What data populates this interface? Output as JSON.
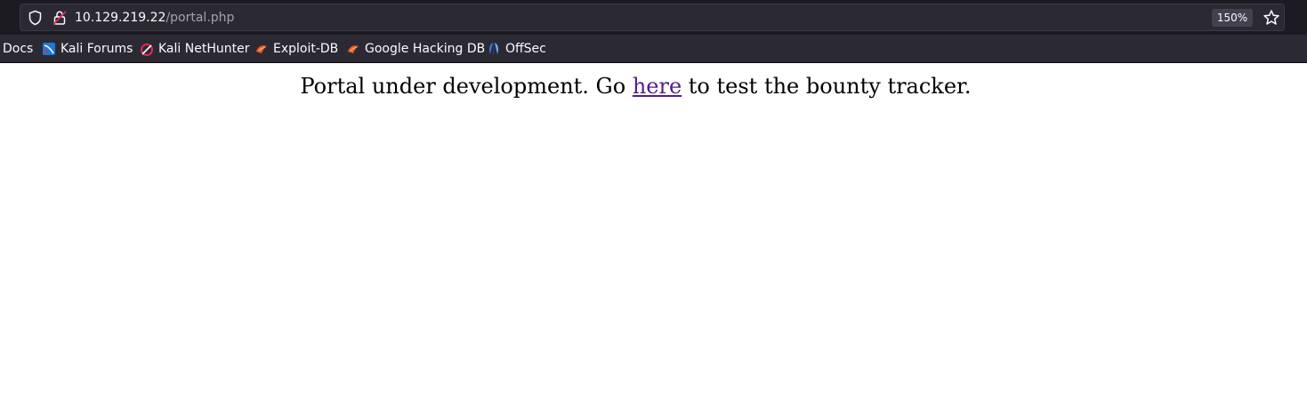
{
  "browser": {
    "url_host": "10.129.219.22",
    "url_path": "/portal.php",
    "zoom": "150%",
    "bookmarks": [
      {
        "label": "Docs",
        "icon": "none"
      },
      {
        "label": "Kali Forums",
        "icon": "kali-forums-icon"
      },
      {
        "label": "Kali NetHunter",
        "icon": "kali-nethunter-icon"
      },
      {
        "label": "Exploit-DB",
        "icon": "exploit-db-icon"
      },
      {
        "label": "Google Hacking DB",
        "icon": "ghdb-icon"
      },
      {
        "label": "OffSec",
        "icon": "offsec-icon"
      }
    ]
  },
  "page": {
    "text_before": "Portal under development. Go ",
    "link_text": "here",
    "text_after": " to test the bounty tracker.",
    "link_color": "#551a8b"
  }
}
